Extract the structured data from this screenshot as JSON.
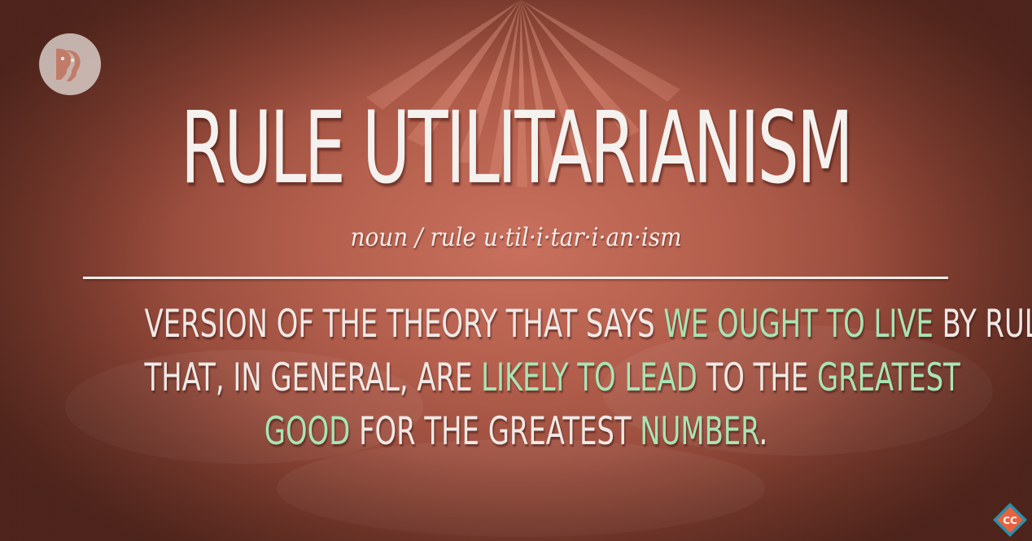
{
  "title": "RULE UTILITARIANISM",
  "pronunciation": "noun / rule u·til·i·tar·i·an·ism",
  "definition": {
    "line1": {
      "a": "VERSION OF THE THEORY THAT SAYS ",
      "b": "WE OUGHT TO LIVE",
      "c": " BY RULES"
    },
    "line2": {
      "a": "THAT, IN GENERAL, ARE ",
      "b": "LIKELY TO LEAD",
      "c": " TO THE ",
      "d": "GREATEST"
    },
    "line3": {
      "a": "GOOD",
      "b": " FOR THE GREATEST ",
      "c": "NUMBER",
      "d": "."
    }
  },
  "badge": {
    "label": "CC"
  },
  "colors": {
    "background": "#b45f4d",
    "text": "#f5f1ee",
    "highlight": "#a8e4b4",
    "badge": "#2b8fa8"
  },
  "icons": [
    "pbs-logo-icon",
    "crash-course-cc-icon"
  ]
}
